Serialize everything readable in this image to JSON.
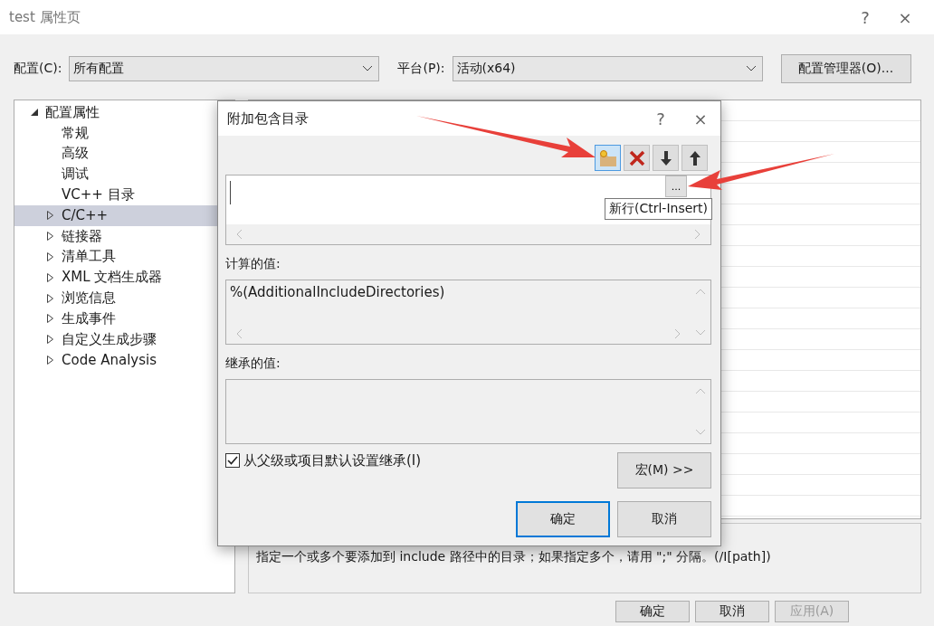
{
  "window": {
    "title": "test 属性页",
    "help": "?",
    "close": "×"
  },
  "config": {
    "label": "配置(C):",
    "value": "所有配置"
  },
  "platform": {
    "label": "平台(P):",
    "value": "活动(x64)"
  },
  "manager_button": "配置管理器(O)...",
  "tree": [
    {
      "label": "配置属性",
      "expanded": true,
      "selected": false,
      "children": [
        {
          "label": "常规",
          "expandable": false,
          "selected": false
        },
        {
          "label": "高级",
          "expandable": false,
          "selected": false
        },
        {
          "label": "调试",
          "expandable": false,
          "selected": false
        },
        {
          "label": "VC++ 目录",
          "expandable": false,
          "selected": false
        },
        {
          "label": "C/C++",
          "expandable": true,
          "selected": true
        },
        {
          "label": "链接器",
          "expandable": true,
          "selected": false
        },
        {
          "label": "清单工具",
          "expandable": true,
          "selected": false
        },
        {
          "label": "XML 文档生成器",
          "expandable": true,
          "selected": false
        },
        {
          "label": "浏览信息",
          "expandable": true,
          "selected": false
        },
        {
          "label": "生成事件",
          "expandable": true,
          "selected": false
        },
        {
          "label": "自定义生成步骤",
          "expandable": true,
          "selected": false
        },
        {
          "label": "Code Analysis",
          "expandable": true,
          "selected": false
        }
      ]
    }
  ],
  "description": "指定一个或多个要添加到 include 路径中的目录；如果指定多个，请用 \";\" 分隔。(/I[path])",
  "buttons": [
    {
      "label": "确定",
      "disabled": false
    },
    {
      "label": "取消",
      "disabled": false
    },
    {
      "label": "应用(A)",
      "disabled": true
    }
  ],
  "dialog": {
    "title": "附加包含目录",
    "help": "?",
    "close": "×",
    "toolbar": [
      {
        "kind": "new",
        "selected": true
      },
      {
        "kind": "delete",
        "selected": false
      },
      {
        "kind": "down",
        "selected": false
      },
      {
        "kind": "up",
        "selected": false
      }
    ],
    "browse_button": "...",
    "tooltip": "新行(Ctrl-Insert)",
    "computed_label": "计算的值:",
    "computed_value": "%(AdditionalIncludeDirectories)",
    "inherited_label": "继承的值:",
    "inherit": {
      "label": "从父级或项目默认设置继承(I)",
      "checked": true
    },
    "macro_button": "宏(M) >>",
    "ok": "确定",
    "cancel": "取消"
  }
}
